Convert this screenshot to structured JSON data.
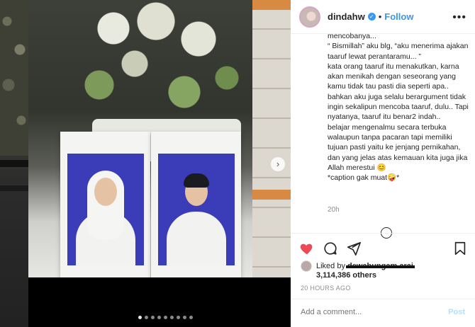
{
  "post": {
    "username": "dindahw",
    "verified_mark": "✓",
    "separator": "•",
    "follow_label": "Follow",
    "more_label": "•••",
    "caption_lines": [
      "mencobanya...",
      "“ Bismillah” aku blg, “aku menerima ajakan taaruf lewat perantaramu... ”",
      "kata orang taaruf itu menakutkan, karna akan menikah dengan seseorang yang kamu tidak tau pasti dia seperti apa.. bahkan aku juga selalu berargument tidak ingin sekalipun mencoba taaruf, dulu.. Tapi nyatanya, taaruf itu benar2 indah..",
      "belajar mengenalmu secara terbuka walaupun tanpa pacaran tapi memiliki tujuan pasti yaitu ke jenjang pernikahan, dan yang jelas atas kemauan kita juga jika Allah merestui 😊",
      "*caption gak muat🤪*"
    ],
    "caption_time": "20h",
    "liked_by_prefix": "Liked by",
    "liked_by_user": "dewabungam arai",
    "likes_count": "3,114,386",
    "likes_suffix": "others",
    "posted_ago": "20 HOURS AGO",
    "comment_placeholder": "Add a comment...",
    "post_label": "Post"
  },
  "carousel": {
    "next_arrow": "›",
    "dot_count": 9,
    "active_dot": 0
  },
  "colors": {
    "accent": "#3897f0",
    "like_red": "#ed4956",
    "brick_orange": "#d98a42",
    "photo_blue_bg": "#3b3cb8"
  },
  "icons": {
    "like": "heart-icon",
    "comment": "comment-icon",
    "share": "share-icon",
    "save": "bookmark-icon",
    "verified": "verified-icon",
    "more": "more-options-icon",
    "next": "chevron-right-icon"
  }
}
